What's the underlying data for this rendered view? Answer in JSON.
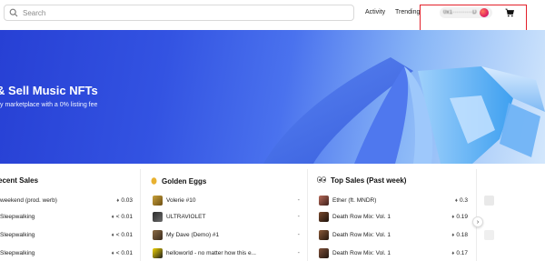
{
  "nav": {
    "search_placeholder": "Search",
    "activity": "Activity",
    "trending": "Trending",
    "wallet_text": "0x1··········D"
  },
  "hero": {
    "title": "& Sell Music NFTs",
    "subtitle": "y marketplace with a 0% listing fee"
  },
  "recent_sales": {
    "title": "ecent Sales",
    "rows": [
      {
        "name": "weekend (prod. werb)",
        "price": "0.03"
      },
      {
        "name": "Sleepwalking",
        "price": "< 0.01"
      },
      {
        "name": "Sleepwalking",
        "price": "< 0.01"
      },
      {
        "name": "Sleepwalking",
        "price": "< 0.01"
      }
    ]
  },
  "golden_eggs": {
    "title": "Golden Eggs",
    "rows": [
      {
        "name": "Volerie #10",
        "value": "-"
      },
      {
        "name": "ULTRAVIOLET",
        "value": "-"
      },
      {
        "name": "My Dave (Demo) #1",
        "value": "-"
      },
      {
        "name": "helloworld - no matter how this e...",
        "value": "-"
      }
    ]
  },
  "top_sales": {
    "title": "Top Sales (Past week)",
    "rows": [
      {
        "name": "Ether (ft. MNDR)",
        "price": "0.3"
      },
      {
        "name": "Death Row Mix: Vol. 1",
        "price": "0.19"
      },
      {
        "name": "Death Row Mix: Vol. 1",
        "price": "0.18"
      },
      {
        "name": "Death Row Mix: Vol. 1",
        "price": "0.17"
      }
    ]
  },
  "scroll_next": "›",
  "icons": {
    "search": "search-icon",
    "cart": "cart-icon",
    "egg": "egg-icon",
    "eyes": "eyes-icon",
    "eth": "eth-icon"
  },
  "colors": {
    "hero_start": "#2740d4",
    "hero_end": "#d3e7fc",
    "highlight": "#e3202a"
  }
}
